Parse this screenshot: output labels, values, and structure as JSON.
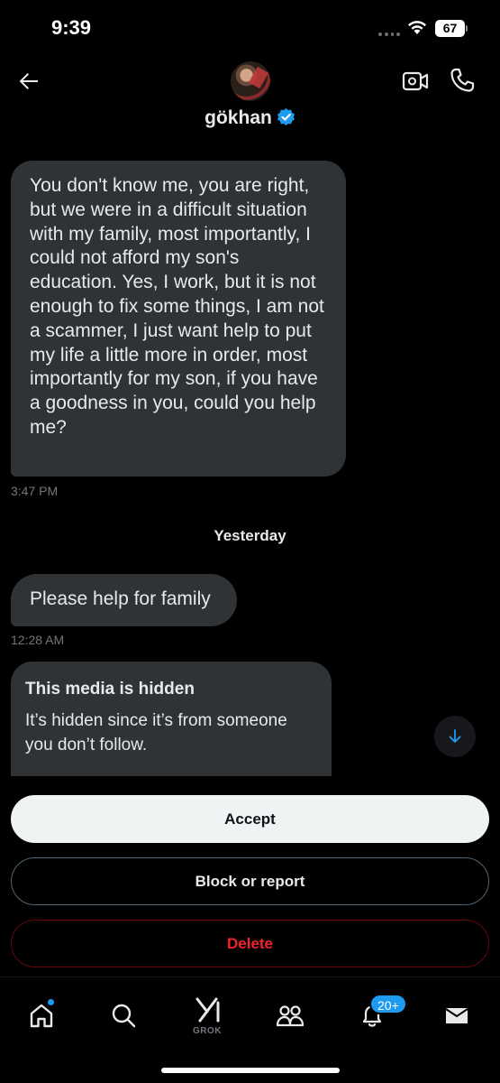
{
  "status_bar": {
    "time": "9:39",
    "battery": "67"
  },
  "header": {
    "contact_name": "gökhan",
    "verified": true,
    "icons": [
      "back-arrow-icon",
      "video-call-icon",
      "phone-call-icon",
      "verified-badge-icon"
    ]
  },
  "messages": [
    {
      "text": "You don't know me, you are right, but we were in a difficult situation with my family, most importantly, I could not afford my son's education. Yes, I work, but it is not enough to fix some things, I am not a scammer, I just want help to put my life a little more in order, most importantly for my son, if you have a goodness in you, could you help me?",
      "time": "3:47 PM"
    },
    {
      "text": "Please help for family",
      "time": "12:28 AM"
    }
  ],
  "date_separator": "Yesterday",
  "hidden_media": {
    "title": "This media is hidden",
    "subtitle": "It’s hidden since it’s from someone you don’t follow."
  },
  "actions": {
    "accept": "Accept",
    "block_report": "Block or report",
    "delete": "Delete"
  },
  "nav": {
    "grok_label": "GROK",
    "notifications_badge": "20+",
    "items": [
      "home-icon",
      "search-icon",
      "grok-icon",
      "communities-icon",
      "notifications-icon",
      "messages-icon"
    ]
  },
  "colors": {
    "background": "#000000",
    "bubble": "#2f3336",
    "accent": "#1d9bf0",
    "danger": "#f4212e",
    "muted": "#71767b"
  }
}
